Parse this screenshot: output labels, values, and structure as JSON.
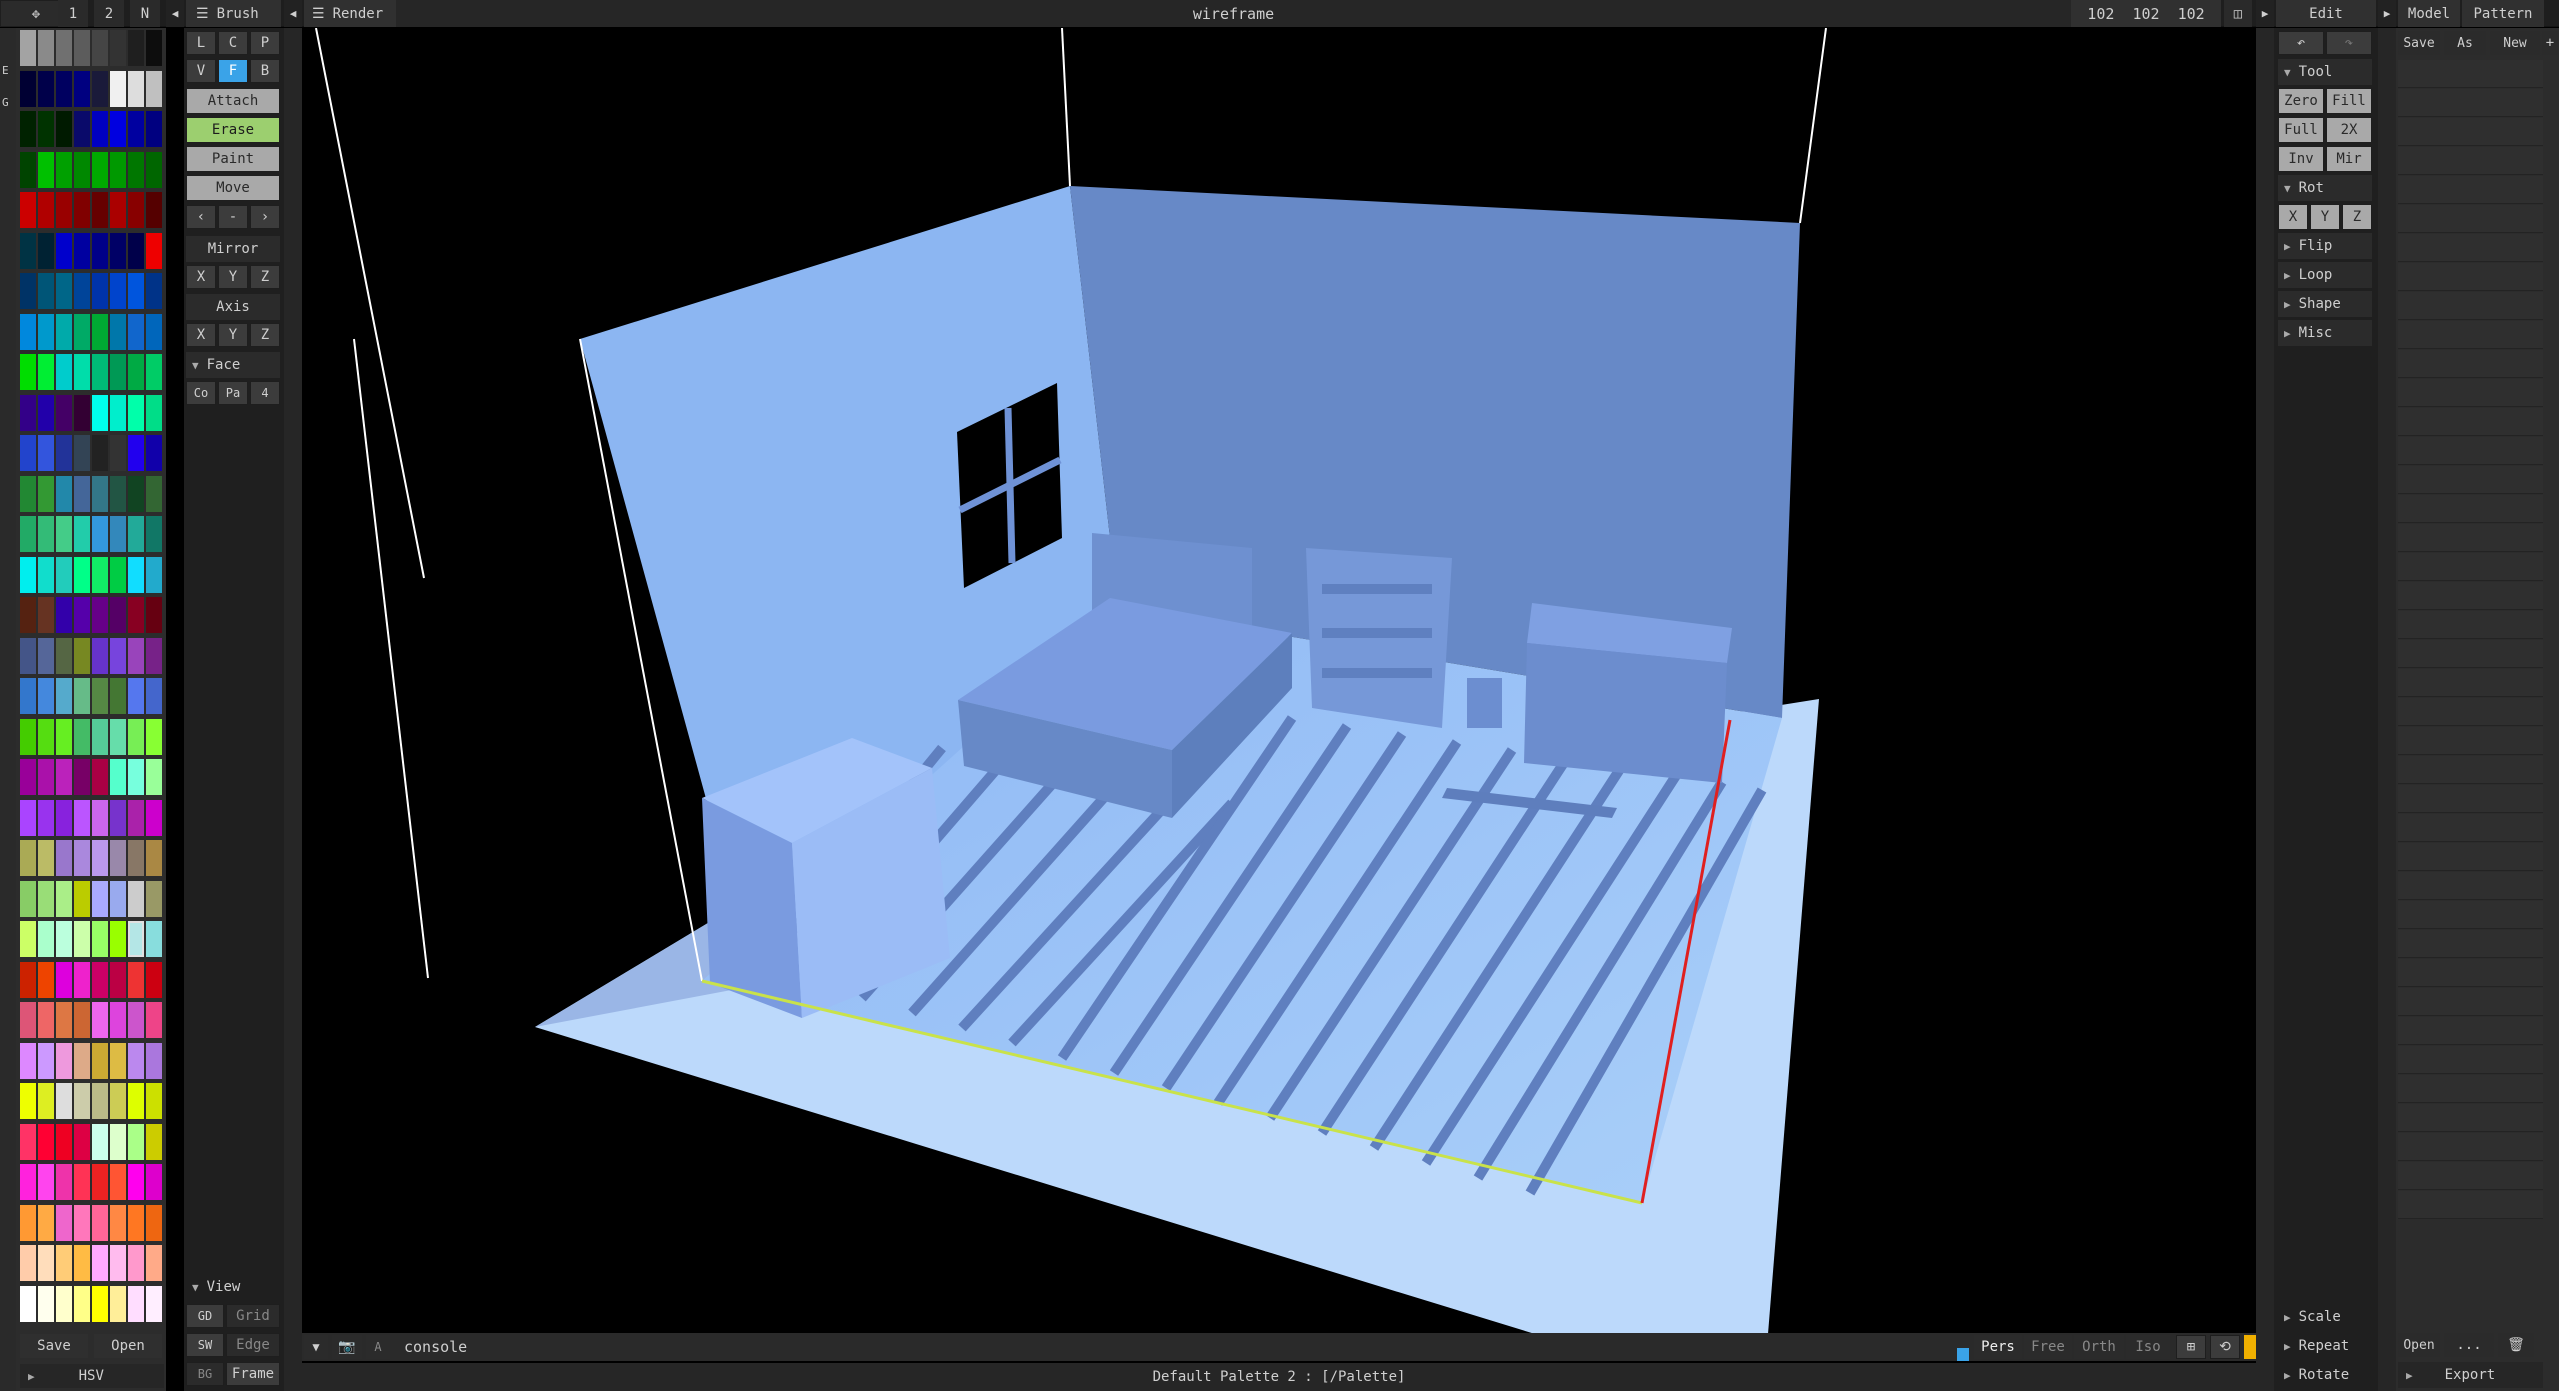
{
  "top": {
    "left_tabs": [
      "1",
      "2",
      "N"
    ],
    "brush_label": "Brush",
    "render_label": "Render",
    "mode_title": "wireframe",
    "dimensions": "102  102  102",
    "edit_label": "Edit",
    "model_tab": "Model",
    "pattern_tab": "Pattern"
  },
  "left_strip": [
    "E",
    "G"
  ],
  "palette": {
    "save": "Save",
    "open": "Open",
    "hsv": "HSV",
    "colors": [
      [
        "#a3a3a3",
        "#8a8a8a",
        "#707070",
        "#5c5c5c",
        "#454545",
        "#333333",
        "#1f1f1f",
        "#0d0d0d"
      ],
      [
        "#000033",
        "#00004a",
        "#000060",
        "#000080",
        "#1a1a3a",
        "#f0f0f0",
        "#dddddd",
        "#c0c0c0"
      ],
      [
        "#002200",
        "#003300",
        "#001a00",
        "#0a0a6a",
        "#0000c0",
        "#0000e0",
        "#0000a0",
        "#000080"
      ],
      [
        "#004400",
        "#00c000",
        "#00a000",
        "#008800",
        "#00aa00",
        "#009900",
        "#007700",
        "#006600"
      ],
      [
        "#cc0000",
        "#b00000",
        "#990000",
        "#800000",
        "#660000",
        "#aa0000",
        "#880000",
        "#550000"
      ],
      [
        "#003344",
        "#002233",
        "#0000cc",
        "#0000a0",
        "#000088",
        "#000066",
        "#00004a",
        "#ee0000"
      ],
      [
        "#003366",
        "#005577",
        "#006688",
        "#004499",
        "#0033aa",
        "#0044cc",
        "#0055dd",
        "#003388"
      ],
      [
        "#0088dd",
        "#0099cc",
        "#00aaaa",
        "#00aa66",
        "#00aa33",
        "#0077aa",
        "#1166cc",
        "#0066bb"
      ],
      [
        "#00dd00",
        "#00ee33",
        "#00cccc",
        "#00ddaa",
        "#00bb77",
        "#009955",
        "#00aa44",
        "#00cc66"
      ],
      [
        "#330088",
        "#2200aa",
        "#440066",
        "#330033",
        "#00ffee",
        "#00eecc",
        "#00ffaa",
        "#00dd88"
      ],
      [
        "#2244cc",
        "#3355dd",
        "#223399",
        "#334455",
        "#222222",
        "#333333",
        "#2200ee",
        "#1100aa"
      ],
      [
        "#228833",
        "#339933",
        "#2288aa",
        "#446699",
        "#337788",
        "#225544",
        "#114422",
        "#336633"
      ],
      [
        "#22aa66",
        "#33bb77",
        "#44cc88",
        "#22ccaa",
        "#3399dd",
        "#3388bb",
        "#22aa99",
        "#117766"
      ],
      [
        "#00eeee",
        "#11ddcc",
        "#22ccbb",
        "#00ff88",
        "#11ee66",
        "#00cc44",
        "#11ddff",
        "#22aacc"
      ],
      [
        "#552211",
        "#663322",
        "#3300aa",
        "#5500aa",
        "#660088",
        "#550066",
        "#880022",
        "#660011"
      ],
      [
        "#445588",
        "#556699",
        "#556644",
        "#778822",
        "#6633cc",
        "#7744dd",
        "#9944bb",
        "#772288"
      ],
      [
        "#3377cc",
        "#4488dd",
        "#55aacc",
        "#66bb88",
        "#558844",
        "#447733",
        "#5577ee",
        "#4466cc"
      ],
      [
        "#44cc00",
        "#55dd11",
        "#66ee22",
        "#44bb66",
        "#55cc99",
        "#66ddaa",
        "#77ee55",
        "#88ff33"
      ],
      [
        "#990099",
        "#aa11aa",
        "#bb22bb",
        "#770066",
        "#aa0044",
        "#55ffcc",
        "#77ffdd",
        "#99ff99"
      ],
      [
        "#aa44ff",
        "#9933ee",
        "#8822dd",
        "#bb55ff",
        "#cc66ee",
        "#7733cc",
        "#aa22aa",
        "#cc00cc"
      ],
      [
        "#aaaa55",
        "#bbbb66",
        "#9977cc",
        "#aa88dd",
        "#bb99ee",
        "#9988aa",
        "#887766",
        "#aa8844"
      ],
      [
        "#88cc66",
        "#99dd77",
        "#aaee88",
        "#bbcc00",
        "#aaaaff",
        "#99aaee",
        "#cccccc",
        "#999966"
      ],
      [
        "#ccff66",
        "#aaffcc",
        "#bbffdd",
        "#ccffaa",
        "#99ff66",
        "#99ff00",
        "#b4e6e6",
        "#88dddd"
      ],
      [
        "#cc2200",
        "#ee4400",
        "#dd00dd",
        "#ee22cc",
        "#cc0066",
        "#bb0044",
        "#ee3333",
        "#cc0011"
      ],
      [
        "#dd5577",
        "#ee6666",
        "#dd7744",
        "#cc6633",
        "#ee66ee",
        "#dd44dd",
        "#cc55cc",
        "#ee4488"
      ],
      [
        "#dd88ff",
        "#cc99ff",
        "#ee99dd",
        "#ddaa88",
        "#ccaa33",
        "#ddbb44",
        "#bb88ee",
        "#aa77dd"
      ],
      [
        "#eeff00",
        "#ddee22",
        "#dddddd",
        "#ccccaa",
        "#bbbb88",
        "#cccc55",
        "#ddff00",
        "#cce000"
      ],
      [
        "#ff3366",
        "#ff0033",
        "#ee0022",
        "#dd0044",
        "#ccffee",
        "#ddffcc",
        "#aaff88",
        "#cccc00"
      ],
      [
        "#ff22dd",
        "#ff44ee",
        "#ee33aa",
        "#ff3355",
        "#ee2222",
        "#ff5533",
        "#ff00ee",
        "#dd00cc"
      ],
      [
        "#ff9933",
        "#ffaa44",
        "#ee66cc",
        "#ff77bb",
        "#ff6699",
        "#ff8844",
        "#ff7722",
        "#ee6611"
      ],
      [
        "#ffccaa",
        "#ffddbb",
        "#ffcc77",
        "#ffbb44",
        "#ffaaff",
        "#ffbbee",
        "#ff99cc",
        "#ffaa88"
      ],
      [
        "#ffffff",
        "#ffffee",
        "#ffffcc",
        "#ffff88",
        "#ffff00",
        "#ffee99",
        "#ffddff",
        "#ffeeff"
      ]
    ]
  },
  "brush": {
    "row1": [
      "L",
      "C",
      "P"
    ],
    "row2": [
      "V",
      "F",
      "B"
    ],
    "attach": "Attach",
    "erase": "Erase",
    "paint": "Paint",
    "move": "Move",
    "arrows": [
      "‹",
      "-",
      "›"
    ],
    "mirror": "Mirror",
    "xyz1": [
      "X",
      "Y",
      "Z"
    ],
    "axis": "Axis",
    "xyz2": [
      "X",
      "Y",
      "Z"
    ],
    "face": "Face",
    "face_row": [
      "Co",
      "Pa",
      "4"
    ],
    "view": "View",
    "gd": "GD",
    "grid": "Grid",
    "sw": "SW",
    "edge": "Edge",
    "bg": "BG",
    "frame": "Frame"
  },
  "viewport": {
    "console": "console",
    "a_label": "A",
    "cam_modes": [
      "Pers",
      "Free",
      "Orth",
      "Iso"
    ],
    "status": "Default Palette 2 : [/Palette]"
  },
  "edit": {
    "tool": "Tool",
    "zero": "Zero",
    "fill": "Fill",
    "full": "Full",
    "x2": "2X",
    "inv": "Inv",
    "mir": "Mir",
    "rot": "Rot",
    "rot_xyz": [
      "X",
      "Y",
      "Z"
    ],
    "flip": "Flip",
    "loop": "Loop",
    "shape": "Shape",
    "misc": "Misc",
    "scale": "Scale",
    "repeat": "Repeat",
    "rotate": "Rotate"
  },
  "model": {
    "save": "Save",
    "as": "As",
    "new": "New",
    "plus": "+",
    "open": "Open",
    "dots": "...",
    "export": "Export"
  }
}
